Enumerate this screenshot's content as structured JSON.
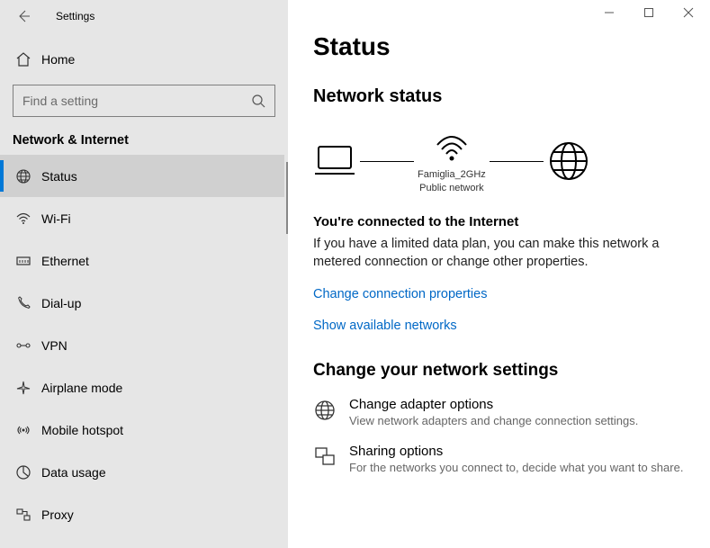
{
  "window": {
    "title": "Settings"
  },
  "sidebar": {
    "home": "Home",
    "search_placeholder": "Find a setting",
    "group": "Network & Internet",
    "items": [
      {
        "label": "Status"
      },
      {
        "label": "Wi-Fi"
      },
      {
        "label": "Ethernet"
      },
      {
        "label": "Dial-up"
      },
      {
        "label": "VPN"
      },
      {
        "label": "Airplane mode"
      },
      {
        "label": "Mobile hotspot"
      },
      {
        "label": "Data usage"
      },
      {
        "label": "Proxy"
      }
    ]
  },
  "main": {
    "title": "Status",
    "network_status_h": "Network status",
    "diagram": {
      "wifi_name": "Famiglia_2GHz",
      "wifi_type": "Public network"
    },
    "connected_h": "You're connected to the Internet",
    "connected_p": "If you have a limited data plan, you can make this network a metered connection or change other properties.",
    "link_change_props": "Change connection properties",
    "link_show_networks": "Show available networks",
    "change_settings_h": "Change your network settings",
    "adapter": {
      "title": "Change adapter options",
      "desc": "View network adapters and change connection settings."
    },
    "sharing": {
      "title": "Sharing options",
      "desc": "For the networks you connect to, decide what you want to share."
    }
  }
}
